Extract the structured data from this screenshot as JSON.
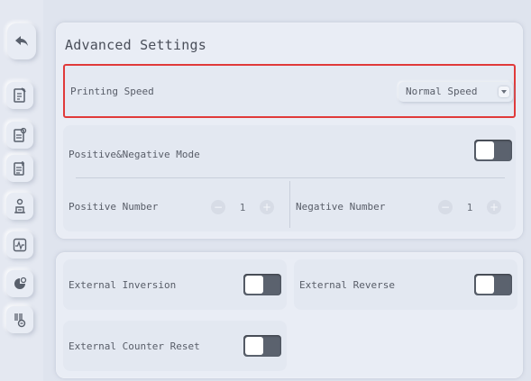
{
  "sidebar": {
    "items": [
      {
        "name": "back-icon"
      },
      {
        "name": "document-edit-icon"
      },
      {
        "name": "document-settings-icon"
      },
      {
        "name": "document-list-icon"
      },
      {
        "name": "user-print-icon"
      },
      {
        "name": "waveform-icon"
      },
      {
        "name": "color-settings-icon"
      },
      {
        "name": "barcode-settings-icon"
      }
    ]
  },
  "advanced": {
    "title": "Advanced Settings",
    "printing_speed": {
      "label": "Printing Speed",
      "value": "Normal Speed"
    },
    "mode": {
      "label": "Positive&Negative Mode",
      "toggle_on": false,
      "positive_label": "Positive Number",
      "positive_value": "1",
      "negative_label": "Negative Number",
      "negative_value": "1",
      "minus": "−",
      "plus": "+"
    }
  },
  "external": {
    "inversion_label": "External Inversion",
    "reverse_label": "External Reverse",
    "counter_reset_label": "External Counter Reset"
  },
  "colors": {
    "highlight_border": "#e03a3a",
    "toggle_track": "#5b626e"
  }
}
